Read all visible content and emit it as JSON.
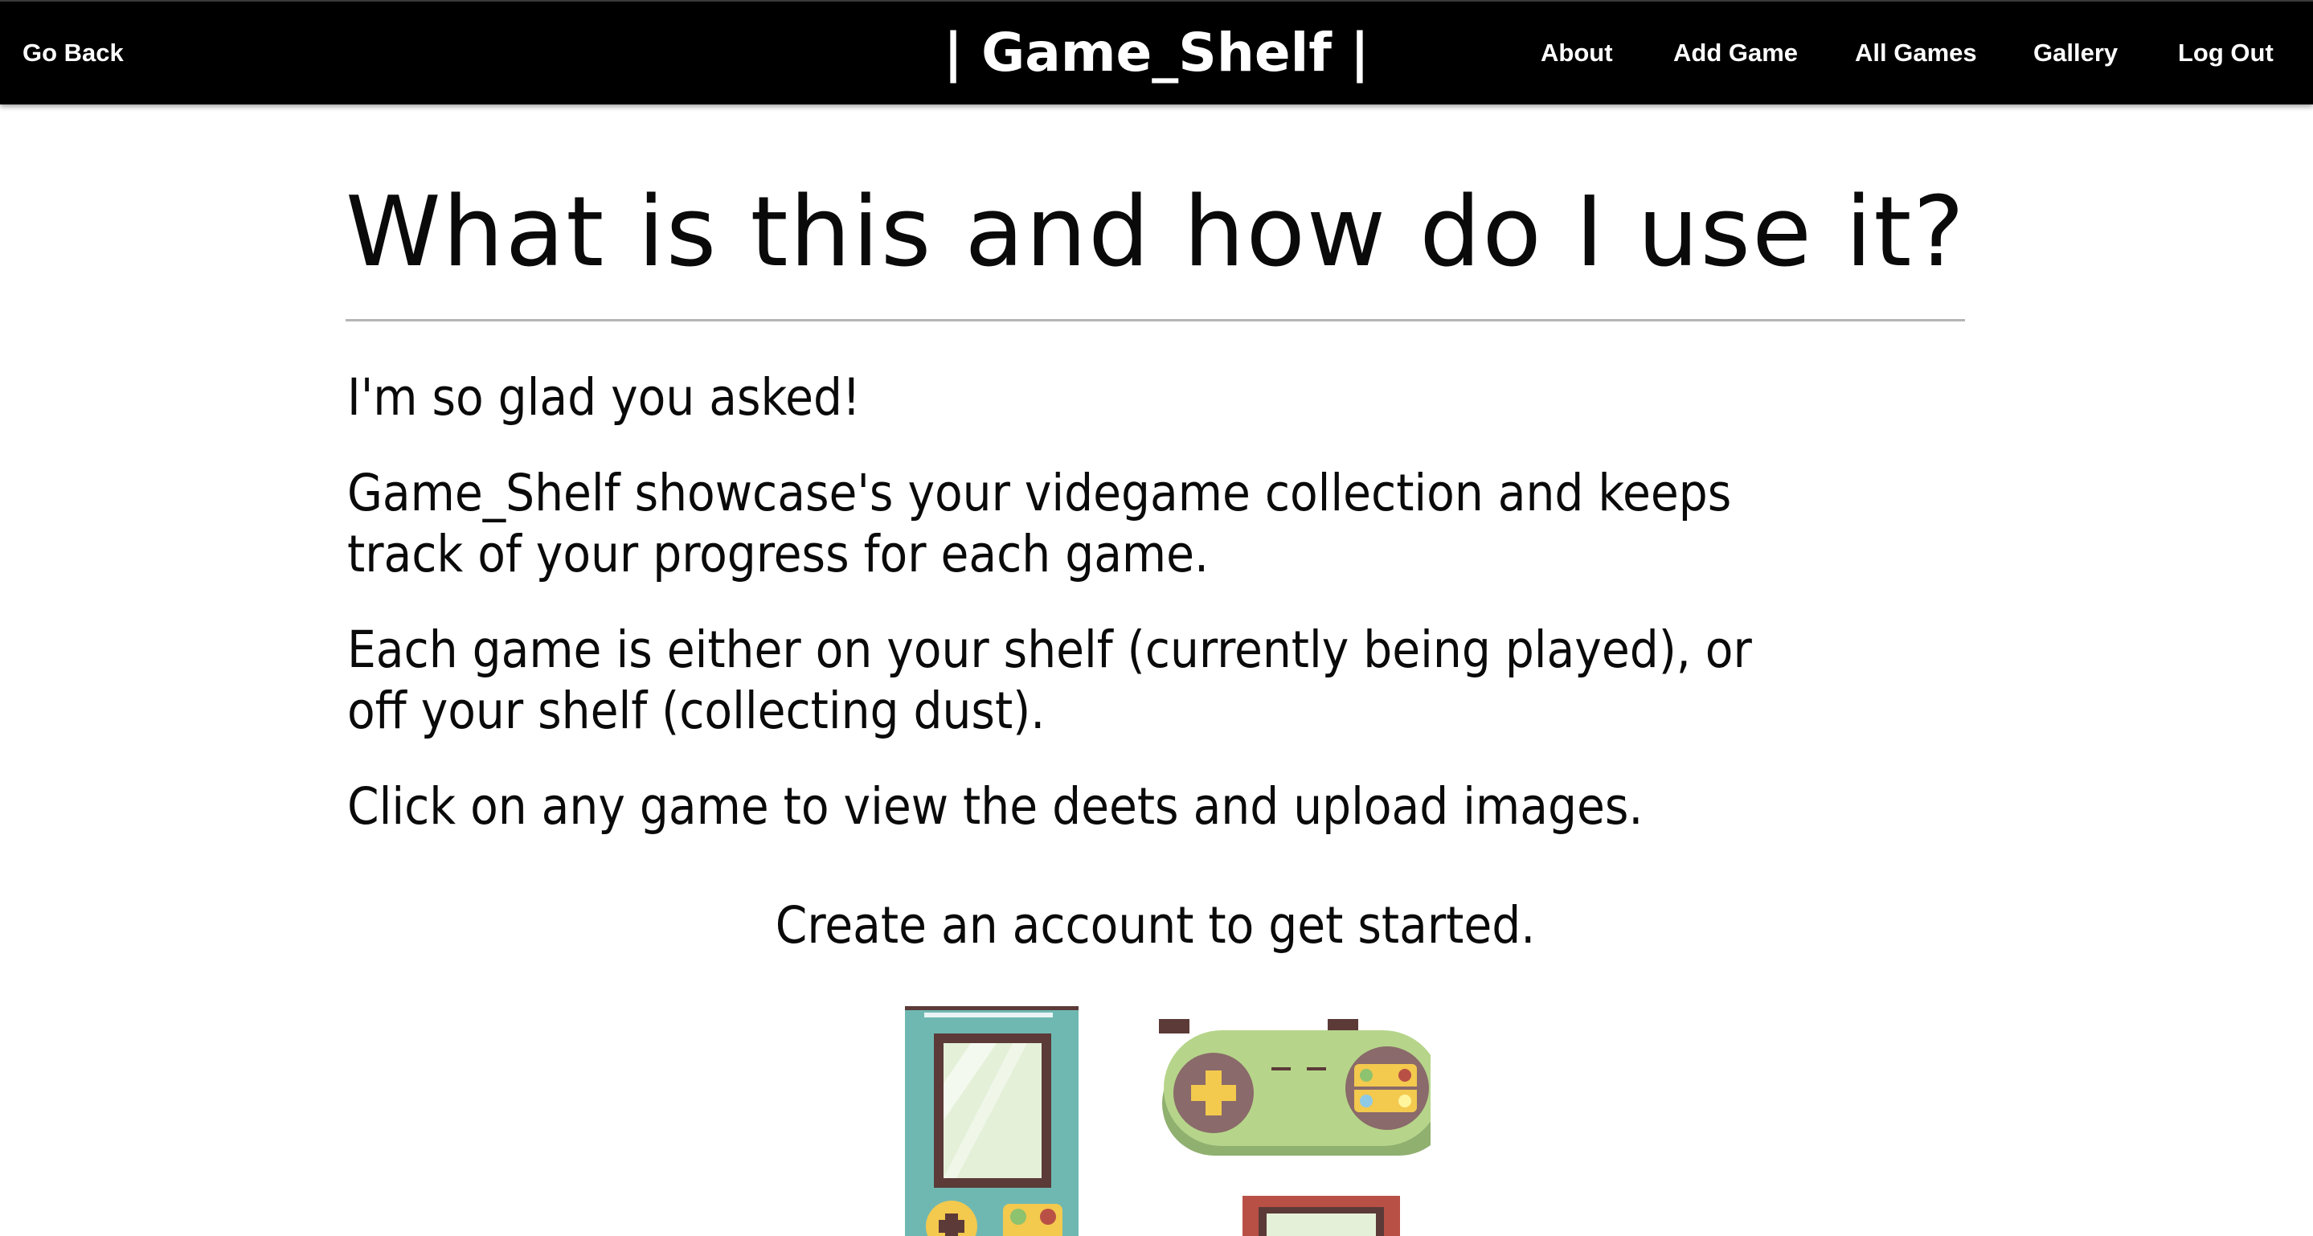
{
  "nav": {
    "back": "Go Back",
    "brand": "| Game_Shelf |",
    "links": [
      "About",
      "Add Game",
      "All Games",
      "Gallery",
      "Log Out"
    ]
  },
  "main": {
    "heading": "What is this and how do I use it?",
    "paragraphs": [
      "I'm so glad you asked!",
      [
        "Game_Shelf showcase's your videgame collection and keeps",
        "track of your progress for each game."
      ],
      [
        "Each game is either on your shelf (currently being played), or",
        "off your shelf (collecting dust)."
      ],
      "Click on any game to view the deets and upload images.",
      "Create an account to get started."
    ]
  },
  "art": {
    "icons": [
      "handheld-console-icon",
      "gamepad-icon",
      "retro-console-icon"
    ],
    "colors": {
      "teal": "#6fb8b2",
      "green": "#b6d58a",
      "brown": "#5b3a38",
      "yellow": "#f3c94e",
      "red": "#b95046",
      "screen": "#e4f0d8"
    }
  }
}
